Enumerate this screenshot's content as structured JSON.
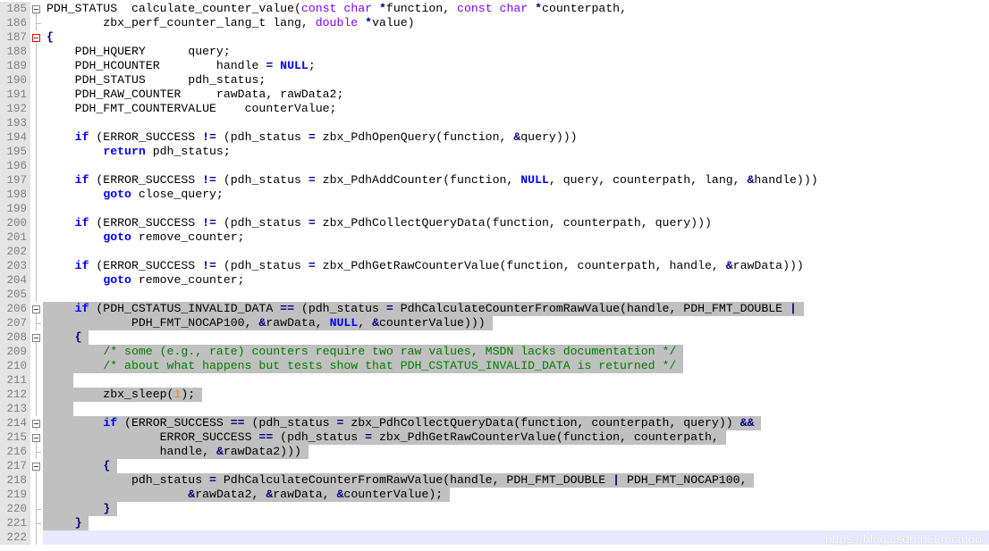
{
  "editor": {
    "lines": [
      {
        "num": "185",
        "fold": "open",
        "hl": 0,
        "tokens": [
          [
            "PDH_STATUS  calculate_counter_value(",
            "p"
          ],
          [
            "const",
            "ty"
          ],
          [
            " ",
            "p"
          ],
          [
            "char",
            "ty"
          ],
          [
            " ",
            "p"
          ],
          [
            "*",
            "op"
          ],
          [
            "function, ",
            "p"
          ],
          [
            "const",
            "ty"
          ],
          [
            " ",
            "p"
          ],
          [
            "char",
            "ty"
          ],
          [
            " ",
            "p"
          ],
          [
            "*",
            "op"
          ],
          [
            "counterpath,",
            "p"
          ]
        ]
      },
      {
        "num": "186",
        "fold": "end",
        "hl": 0,
        "tokens": [
          [
            "        zbx_perf_counter_lang_t lang, ",
            "p"
          ],
          [
            "double",
            "ty"
          ],
          [
            " ",
            "p"
          ],
          [
            "*",
            "op"
          ],
          [
            "value)",
            "p"
          ]
        ]
      },
      {
        "num": "187",
        "fold": "open-red",
        "hl": 0,
        "tokens": [
          [
            "{",
            "op"
          ]
        ]
      },
      {
        "num": "188",
        "fold": "line",
        "hl": 0,
        "tokens": [
          [
            "    PDH_HQUERY      query;",
            "p"
          ]
        ]
      },
      {
        "num": "189",
        "fold": "line",
        "hl": 0,
        "tokens": [
          [
            "    PDH_HCOUNTER        handle ",
            "p"
          ],
          [
            "=",
            "op"
          ],
          [
            " ",
            "p"
          ],
          [
            "NULL",
            "kw"
          ],
          [
            ";",
            "p"
          ]
        ]
      },
      {
        "num": "190",
        "fold": "line",
        "hl": 0,
        "tokens": [
          [
            "    PDH_STATUS      pdh_status;",
            "p"
          ]
        ]
      },
      {
        "num": "191",
        "fold": "line",
        "hl": 0,
        "tokens": [
          [
            "    PDH_RAW_COUNTER     rawData, rawData2;",
            "p"
          ]
        ]
      },
      {
        "num": "192",
        "fold": "line",
        "hl": 0,
        "tokens": [
          [
            "    PDH_FMT_COUNTERVALUE    counterValue;",
            "p"
          ]
        ]
      },
      {
        "num": "193",
        "fold": "line",
        "hl": 0,
        "tokens": [
          [
            "",
            "p"
          ]
        ]
      },
      {
        "num": "194",
        "fold": "line",
        "hl": 0,
        "tokens": [
          [
            "    ",
            "p"
          ],
          [
            "if",
            "kw"
          ],
          [
            " (ERROR_SUCCESS ",
            "p"
          ],
          [
            "!=",
            "op"
          ],
          [
            " (pdh_status ",
            "p"
          ],
          [
            "=",
            "op"
          ],
          [
            " zbx_PdhOpenQuery(function, ",
            "p"
          ],
          [
            "&",
            "op"
          ],
          [
            "query)))",
            "p"
          ]
        ]
      },
      {
        "num": "195",
        "fold": "line",
        "hl": 0,
        "tokens": [
          [
            "        ",
            "p"
          ],
          [
            "return",
            "kw"
          ],
          [
            " pdh_status;",
            "p"
          ]
        ]
      },
      {
        "num": "196",
        "fold": "line",
        "hl": 0,
        "tokens": [
          [
            "",
            "p"
          ]
        ]
      },
      {
        "num": "197",
        "fold": "line",
        "hl": 0,
        "tokens": [
          [
            "    ",
            "p"
          ],
          [
            "if",
            "kw"
          ],
          [
            " (ERROR_SUCCESS ",
            "p"
          ],
          [
            "!=",
            "op"
          ],
          [
            " (pdh_status ",
            "p"
          ],
          [
            "=",
            "op"
          ],
          [
            " zbx_PdhAddCounter(function, ",
            "p"
          ],
          [
            "NULL",
            "kw"
          ],
          [
            ", query, counterpath, lang, ",
            "p"
          ],
          [
            "&",
            "op"
          ],
          [
            "handle)))",
            "p"
          ]
        ]
      },
      {
        "num": "198",
        "fold": "line",
        "hl": 0,
        "tokens": [
          [
            "        ",
            "p"
          ],
          [
            "goto",
            "kw"
          ],
          [
            " close_query;",
            "p"
          ]
        ]
      },
      {
        "num": "199",
        "fold": "line",
        "hl": 0,
        "tokens": [
          [
            "",
            "p"
          ]
        ]
      },
      {
        "num": "200",
        "fold": "line",
        "hl": 0,
        "tokens": [
          [
            "    ",
            "p"
          ],
          [
            "if",
            "kw"
          ],
          [
            " (ERROR_SUCCESS ",
            "p"
          ],
          [
            "!=",
            "op"
          ],
          [
            " (pdh_status ",
            "p"
          ],
          [
            "=",
            "op"
          ],
          [
            " zbx_PdhCollectQueryData(function, counterpath, query)))",
            "p"
          ]
        ]
      },
      {
        "num": "201",
        "fold": "line",
        "hl": 0,
        "tokens": [
          [
            "        ",
            "p"
          ],
          [
            "goto",
            "kw"
          ],
          [
            " remove_counter;",
            "p"
          ]
        ]
      },
      {
        "num": "202",
        "fold": "line",
        "hl": 0,
        "tokens": [
          [
            "",
            "p"
          ]
        ]
      },
      {
        "num": "203",
        "fold": "line",
        "hl": 0,
        "tokens": [
          [
            "    ",
            "p"
          ],
          [
            "if",
            "kw"
          ],
          [
            " (ERROR_SUCCESS ",
            "p"
          ],
          [
            "!=",
            "op"
          ],
          [
            " (pdh_status ",
            "p"
          ],
          [
            "=",
            "op"
          ],
          [
            " zbx_PdhGetRawCounterValue(function, counterpath, handle, ",
            "p"
          ],
          [
            "&",
            "op"
          ],
          [
            "rawData)))",
            "p"
          ]
        ]
      },
      {
        "num": "204",
        "fold": "line",
        "hl": 0,
        "tokens": [
          [
            "        ",
            "p"
          ],
          [
            "goto",
            "kw"
          ],
          [
            " remove_counter;",
            "p"
          ]
        ]
      },
      {
        "num": "205",
        "fold": "line",
        "hl": 0,
        "tokens": [
          [
            "",
            "p"
          ]
        ]
      },
      {
        "num": "206",
        "fold": "open",
        "hl": 1,
        "tokens": [
          [
            "    ",
            "p"
          ],
          [
            "if",
            "kw"
          ],
          [
            " (PDH_CSTATUS_INVALID_DATA ",
            "p"
          ],
          [
            "==",
            "op"
          ],
          [
            " (pdh_status ",
            "p"
          ],
          [
            "=",
            "op"
          ],
          [
            " PdhCalculateCounterFromRawValue(handle, PDH_FMT_DOUBLE ",
            "p"
          ],
          [
            "|",
            "op"
          ]
        ]
      },
      {
        "num": "207",
        "fold": "end",
        "hl": 1,
        "tokens": [
          [
            "            PDH_FMT_NOCAP100, ",
            "p"
          ],
          [
            "&",
            "op"
          ],
          [
            "rawData, ",
            "p"
          ],
          [
            "NULL",
            "kw"
          ],
          [
            ", ",
            "p"
          ],
          [
            "&",
            "op"
          ],
          [
            "counterValue)))",
            "p"
          ]
        ]
      },
      {
        "num": "208",
        "fold": "open",
        "hl": 1,
        "tokens": [
          [
            "    ",
            "p"
          ],
          [
            "{",
            "op"
          ]
        ]
      },
      {
        "num": "209",
        "fold": "line",
        "hl": 1,
        "tokens": [
          [
            "        ",
            "p"
          ],
          [
            "/* some (e.g., rate) counters require two raw values, MSDN lacks documentation */",
            "cm"
          ]
        ]
      },
      {
        "num": "210",
        "fold": "line",
        "hl": 1,
        "tokens": [
          [
            "        ",
            "p"
          ],
          [
            "/* about what happens but tests show that PDH_CSTATUS_INVALID_DATA is returned */",
            "cm"
          ]
        ]
      },
      {
        "num": "211",
        "fold": "line",
        "hl": 1,
        "tokens": [
          [
            "",
            "p"
          ]
        ]
      },
      {
        "num": "212",
        "fold": "line",
        "hl": 1,
        "tokens": [
          [
            "        zbx_sleep(",
            "p"
          ],
          [
            "1",
            "nm"
          ],
          [
            ");",
            "p"
          ]
        ]
      },
      {
        "num": "213",
        "fold": "line",
        "hl": 1,
        "tokens": [
          [
            "",
            "p"
          ]
        ]
      },
      {
        "num": "214",
        "fold": "open",
        "hl": 1,
        "tokens": [
          [
            "        ",
            "p"
          ],
          [
            "if",
            "kw"
          ],
          [
            " (ERROR_SUCCESS ",
            "p"
          ],
          [
            "==",
            "op"
          ],
          [
            " (pdh_status ",
            "p"
          ],
          [
            "=",
            "op"
          ],
          [
            " zbx_PdhCollectQueryData(function, counterpath, query)) ",
            "p"
          ],
          [
            "&&",
            "op"
          ]
        ]
      },
      {
        "num": "215",
        "fold": "open",
        "hl": 1,
        "tokens": [
          [
            "                ERROR_SUCCESS ",
            "p"
          ],
          [
            "==",
            "op"
          ],
          [
            " (pdh_status ",
            "p"
          ],
          [
            "=",
            "op"
          ],
          [
            " zbx_PdhGetRawCounterValue(function, counterpath,",
            "p"
          ]
        ]
      },
      {
        "num": "216",
        "fold": "end",
        "hl": 1,
        "tokens": [
          [
            "                handle, ",
            "p"
          ],
          [
            "&",
            "op"
          ],
          [
            "rawData2)))",
            "p"
          ]
        ]
      },
      {
        "num": "217",
        "fold": "open",
        "hl": 1,
        "tokens": [
          [
            "        ",
            "p"
          ],
          [
            "{",
            "op"
          ]
        ]
      },
      {
        "num": "218",
        "fold": "line",
        "hl": 1,
        "tokens": [
          [
            "            pdh_status ",
            "p"
          ],
          [
            "=",
            "op"
          ],
          [
            " PdhCalculateCounterFromRawValue(handle, PDH_FMT_DOUBLE ",
            "p"
          ],
          [
            "|",
            "op"
          ],
          [
            " PDH_FMT_NOCAP100,",
            "p"
          ]
        ]
      },
      {
        "num": "219",
        "fold": "line",
        "hl": 1,
        "tokens": [
          [
            "                    ",
            "p"
          ],
          [
            "&",
            "op"
          ],
          [
            "rawData2, ",
            "p"
          ],
          [
            "&",
            "op"
          ],
          [
            "rawData, ",
            "p"
          ],
          [
            "&",
            "op"
          ],
          [
            "counterValue);",
            "p"
          ]
        ]
      },
      {
        "num": "220",
        "fold": "end",
        "hl": 1,
        "tokens": [
          [
            "        ",
            "p"
          ],
          [
            "}",
            "op"
          ]
        ]
      },
      {
        "num": "221",
        "fold": "end",
        "hl": 1,
        "tokens": [
          [
            "    ",
            "p"
          ],
          [
            "}",
            "op"
          ]
        ]
      },
      {
        "num": "222",
        "fold": "line",
        "hl": 0,
        "current": true,
        "tokens": [
          [
            "",
            "p"
          ]
        ]
      }
    ]
  },
  "watermark": "https://blog.csdn.net/mcmoo"
}
